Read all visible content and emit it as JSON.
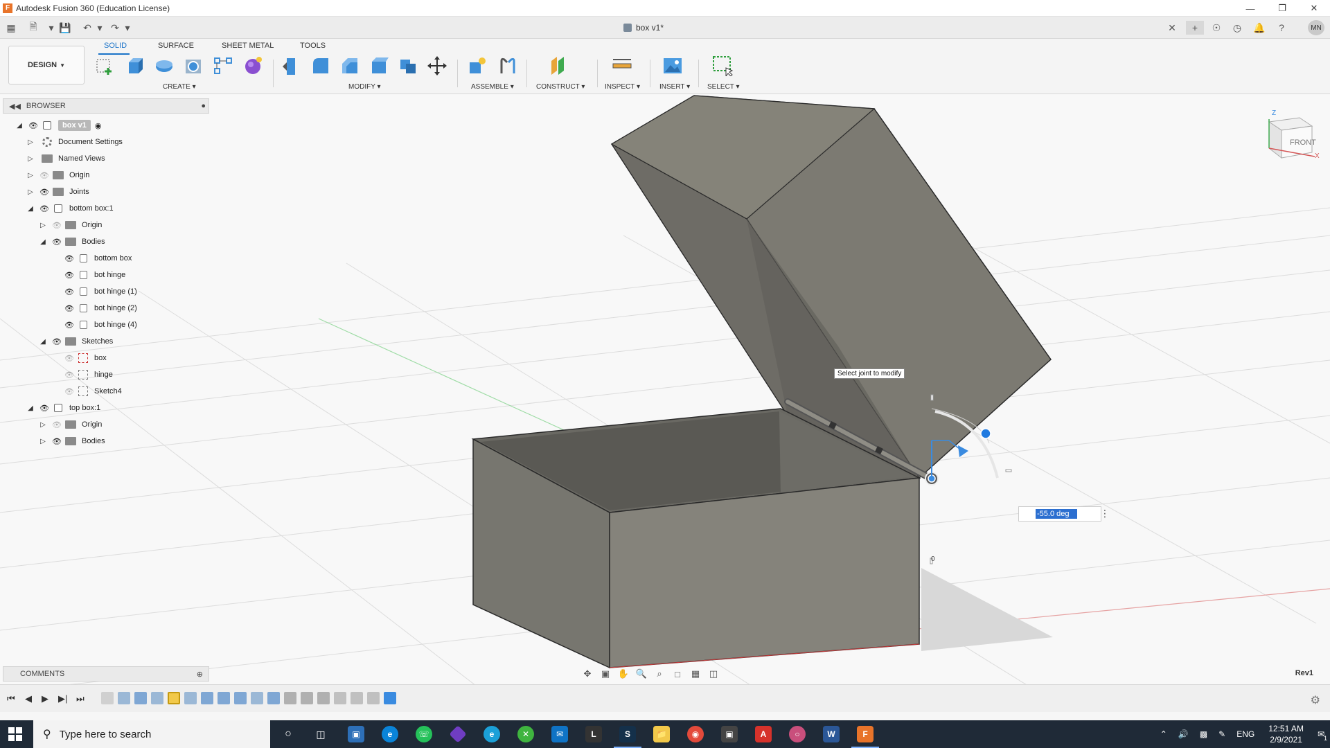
{
  "window": {
    "title": "Autodesk Fusion 360 (Education License)"
  },
  "document_tab": {
    "title": "box v1*"
  },
  "user": {
    "initials": "MN"
  },
  "workspace": {
    "label": "DESIGN"
  },
  "toolbar": {
    "tabs": [
      "SOLID",
      "SURFACE",
      "SHEET METAL",
      "TOOLS"
    ],
    "active_tab": "SOLID",
    "groups": [
      "CREATE",
      "MODIFY",
      "ASSEMBLE",
      "CONSTRUCT",
      "INSPECT",
      "INSERT",
      "SELECT"
    ]
  },
  "browser": {
    "title": "BROWSER",
    "root": "box v1",
    "rows": [
      {
        "label": "Document Settings",
        "icon": "gear-icon"
      },
      {
        "label": "Named Views",
        "icon": "folder-icon"
      },
      {
        "label": "Origin",
        "icon": "folder-icon"
      },
      {
        "label": "Joints",
        "icon": "folder-icon"
      },
      {
        "label": "bottom box:1",
        "icon": "component-icon"
      },
      {
        "label": "Origin",
        "icon": "folder-icon"
      },
      {
        "label": "Bodies",
        "icon": "folder-icon"
      },
      {
        "label": "bottom box",
        "icon": "body-icon"
      },
      {
        "label": "bot hinge",
        "icon": "body-icon"
      },
      {
        "label": "bot hinge (1)",
        "icon": "body-icon"
      },
      {
        "label": "bot hinge (2)",
        "icon": "body-icon"
      },
      {
        "label": "bot hinge (4)",
        "icon": "body-icon"
      },
      {
        "label": "Sketches",
        "icon": "folder-icon"
      },
      {
        "label": "box",
        "icon": "sketch-icon"
      },
      {
        "label": "hinge",
        "icon": "sketch-icon"
      },
      {
        "label": "Sketch4",
        "icon": "sketch-icon"
      },
      {
        "label": "top box:1",
        "icon": "component-icon"
      },
      {
        "label": "Origin",
        "icon": "folder-icon"
      },
      {
        "label": "Bodies",
        "icon": "folder-icon"
      }
    ]
  },
  "viewport": {
    "tooltip": "Select joint to modify",
    "angle_value": "-55.0 deg",
    "viewcube_face": "FRONT",
    "revision": "Rev1",
    "axis_x": "X",
    "axis_z": "Z",
    "marker_0": "0"
  },
  "comments": {
    "title": "COMMENTS"
  },
  "taskbar": {
    "search_placeholder": "Type here to search",
    "language": "ENG",
    "time": "12:51 AM",
    "date": "2/9/2021",
    "notification_count": "1"
  },
  "colors": {
    "accent": "#1a73c8",
    "model_face": "#7e7c74",
    "model_dark": "#5f5e58",
    "taskbar": "#1f2a37"
  }
}
